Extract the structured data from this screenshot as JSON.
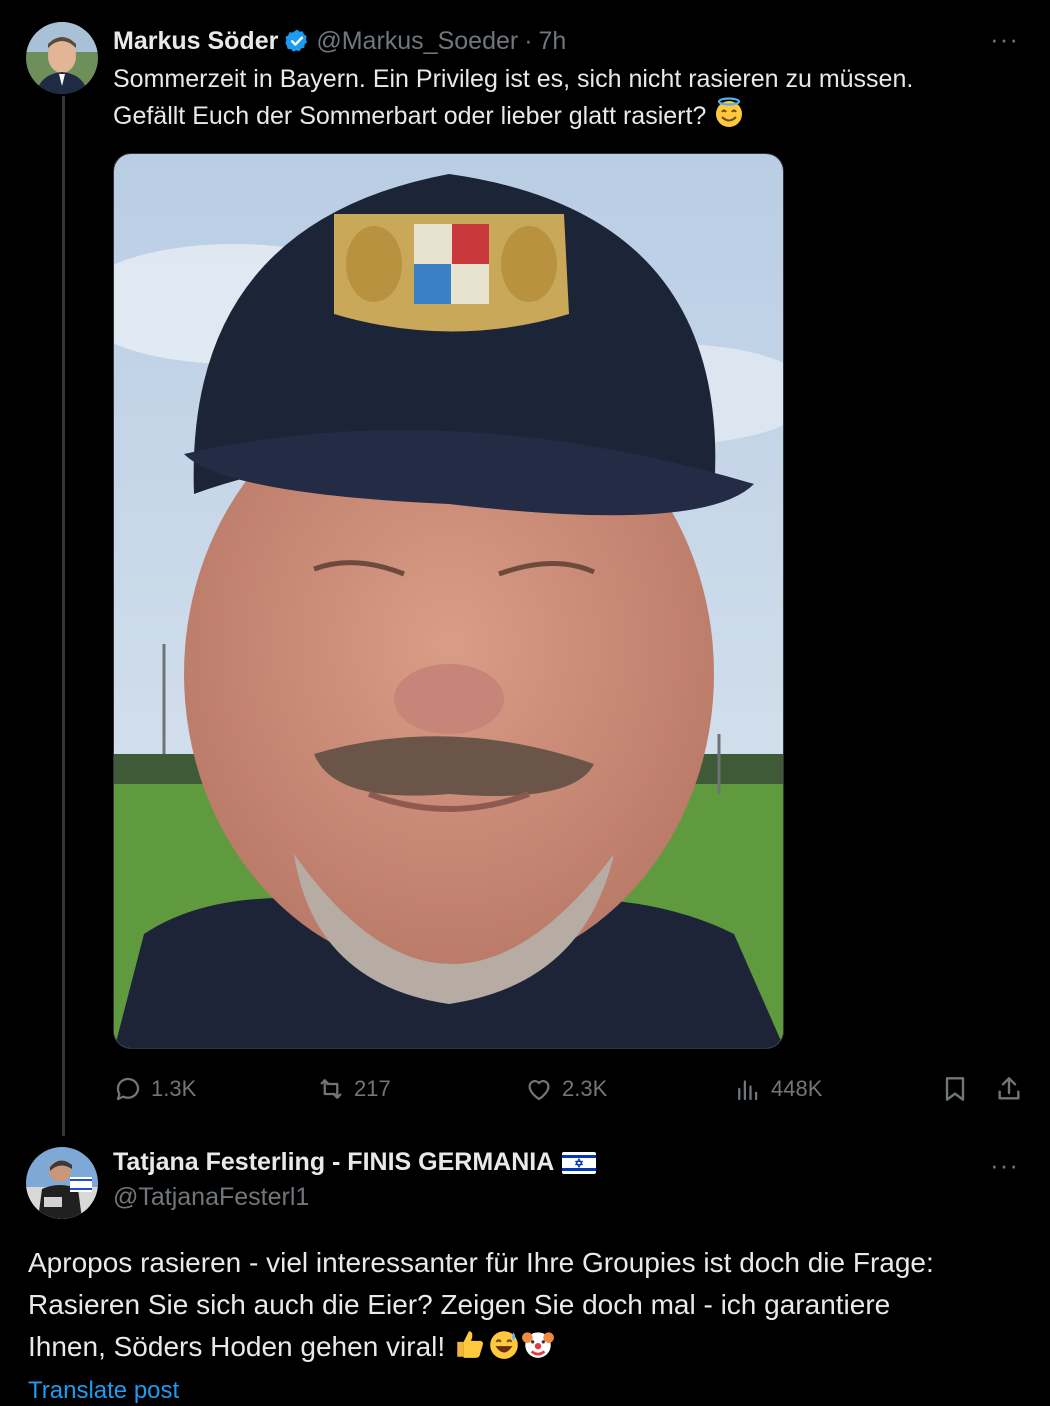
{
  "tweet": {
    "author_name": "Markus Söder",
    "author_handle": "@Markus_Soeder",
    "separator": "·",
    "time": "7h",
    "more": "···",
    "text_line1": "Sommerzeit in Bayern. Ein Privileg ist es, sich nicht rasieren zu müssen.",
    "text_line2": "Gefällt Euch der Sommerbart oder lieber glatt rasiert?",
    "text_emoji": "smiling-face-with-halo",
    "image_icon": "selfie-photo-man-in-cap-with-bavarian-crest",
    "stats": {
      "replies": "1.3K",
      "reposts": "217",
      "likes": "2.3K",
      "views": "448K"
    },
    "action_icons": [
      "reply-icon",
      "repost-icon",
      "like-icon",
      "views-icon",
      "bookmark-icon",
      "share-icon"
    ]
  },
  "reply": {
    "author_name": "Tatjana Festerling - FINIS GERMANIA",
    "flag_icon": "israel-flag-icon",
    "author_handle": "@TatjanaFesterl1",
    "more": "···",
    "text_line1": "Apropos rasieren - viel interessanter für Ihre Groupies ist doch die Frage:",
    "text_line2": "Rasieren Sie sich auch die Eier? Zeigen Sie doch mal - ich garantiere",
    "text_line3": "Ihnen, Söders Hoden gehen viral!",
    "text_emojis": [
      "thumbs-up",
      "grinning-face-with-sweat",
      "clown-face"
    ],
    "translate": "Translate post"
  },
  "colors": {
    "background": "#000000",
    "text": "#e7e9ea",
    "muted": "#71767b",
    "accent": "#1d9bf0",
    "thread_line": "#333639"
  }
}
